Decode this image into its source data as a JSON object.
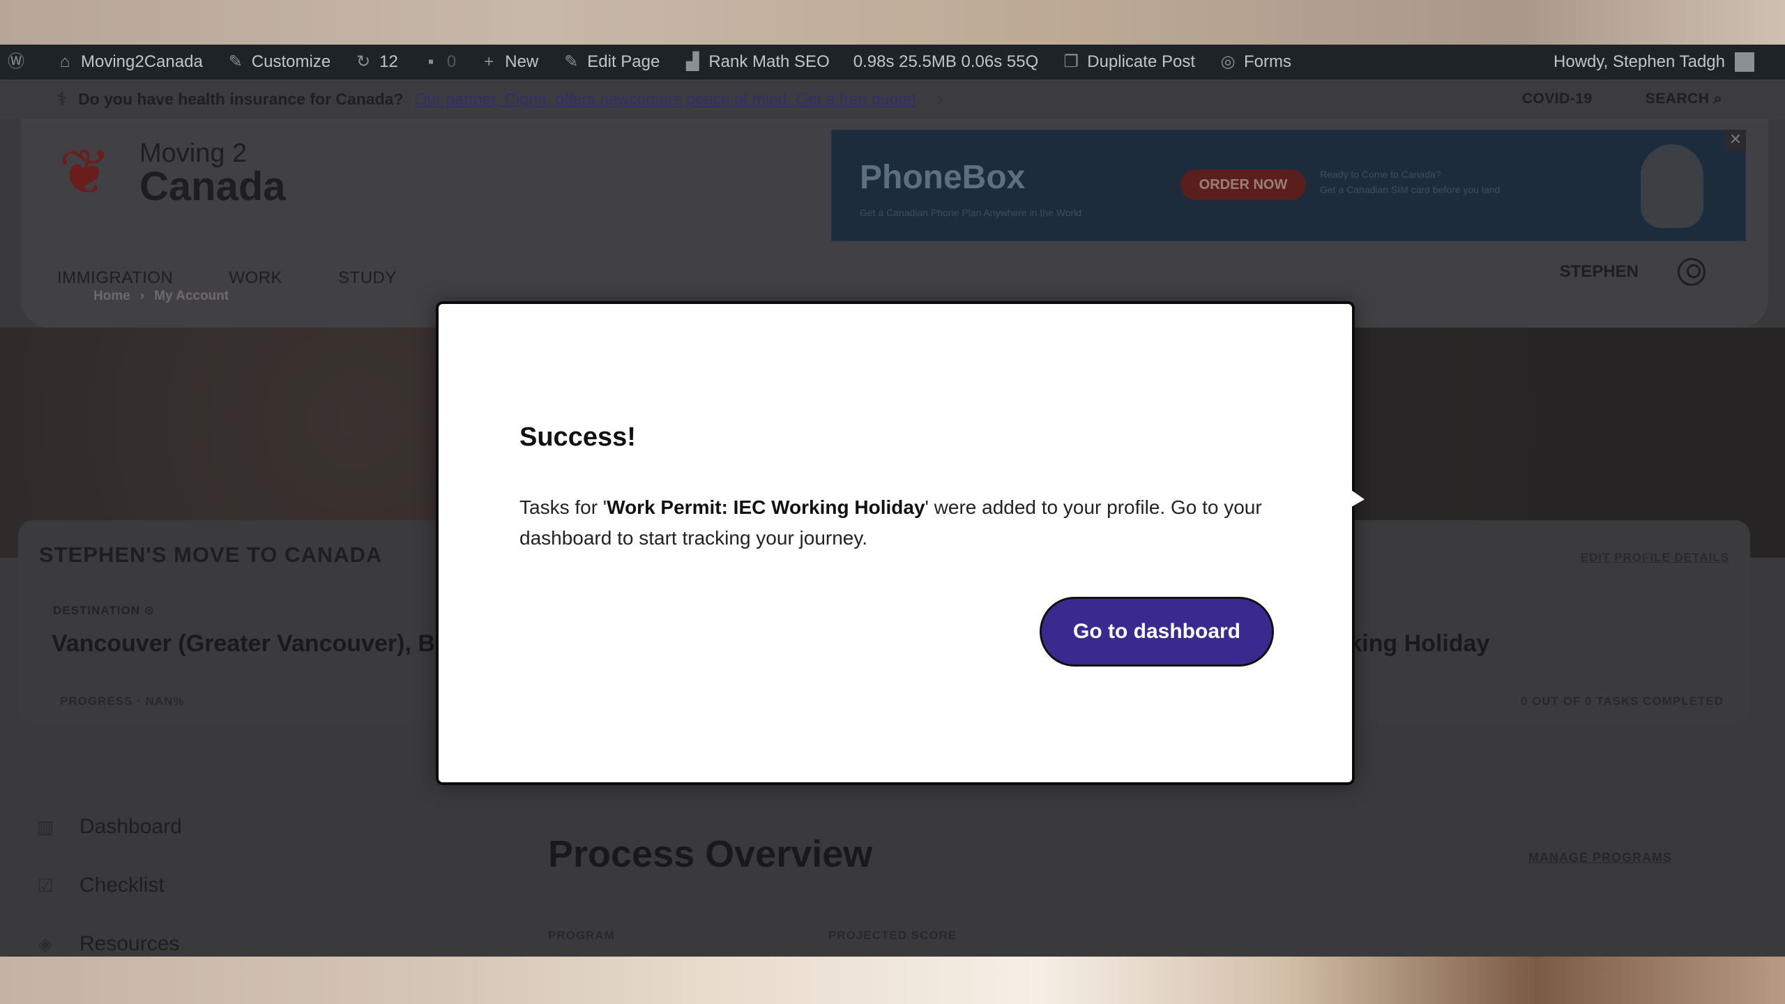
{
  "admin_bar": {
    "site_name": "Moving2Canada",
    "customize": "Customize",
    "updates_count": "12",
    "comments_count": "0",
    "new_label": "New",
    "edit_page": "Edit Page",
    "rank_math": "Rank Math SEO",
    "stats": "0.98s  25.5MB  0.06s  55Q",
    "duplicate_post": "Duplicate Post",
    "forms": "Forms",
    "howdy": "Howdy, Stephen Tadgh"
  },
  "topbar": {
    "question": "Do you have health insurance for Canada?",
    "link": "Our partner, Cigna, offers newcomers peace of mind. Get a free quote!",
    "chevron": "›",
    "covid": "COVID-19",
    "search": "SEARCH"
  },
  "logo": {
    "line1": "Moving 2",
    "line2": "Canada"
  },
  "ad": {
    "brand": "PhoneBox",
    "sub": "Get a Canadian Phone Plan Anywhere in the World",
    "button": "ORDER NOW",
    "text1": "Ready to Come to Canada?",
    "text2": "Get a Canadian SIM card before you land",
    "close": "✕"
  },
  "nav": {
    "items": [
      "IMMIGRATION",
      "WORK",
      "STUDY"
    ],
    "user": "STEPHEN"
  },
  "breadcrumb": {
    "home": "Home",
    "sep": "›",
    "current": "My Account"
  },
  "profile": {
    "title": "STEPHEN'S MOVE TO CANADA",
    "edit": "EDIT PROFILE DETAILS",
    "destination_label": "DESTINATION",
    "destination": "Vancouver (Greater Vancouver), B",
    "program": "rking Holiday",
    "progress": "PROGRESS · NAN%",
    "tasks": "0 OUT OF 0 TASKS COMPLETED"
  },
  "sidebar": {
    "items": [
      {
        "label": "Dashboard",
        "icon": "chart-icon"
      },
      {
        "label": "Checklist",
        "icon": "checkbox-icon"
      },
      {
        "label": "Resources",
        "icon": "resources-icon"
      }
    ]
  },
  "process": {
    "title": "Process Overview",
    "manage": "MANAGE PROGRAMS",
    "col_program": "PROGRAM",
    "col_score": "PROJECTED SCORE"
  },
  "modal": {
    "title": "Success!",
    "body_prefix": "Tasks for '",
    "program": "Work Permit: IEC Working Holiday",
    "body_suffix": "' were added to your profile. Go to your dashboard to start tracking your journey.",
    "button": "Go to dashboard"
  },
  "colors": {
    "accent": "#3a2a8f",
    "admin_bar": "#1d2327"
  }
}
